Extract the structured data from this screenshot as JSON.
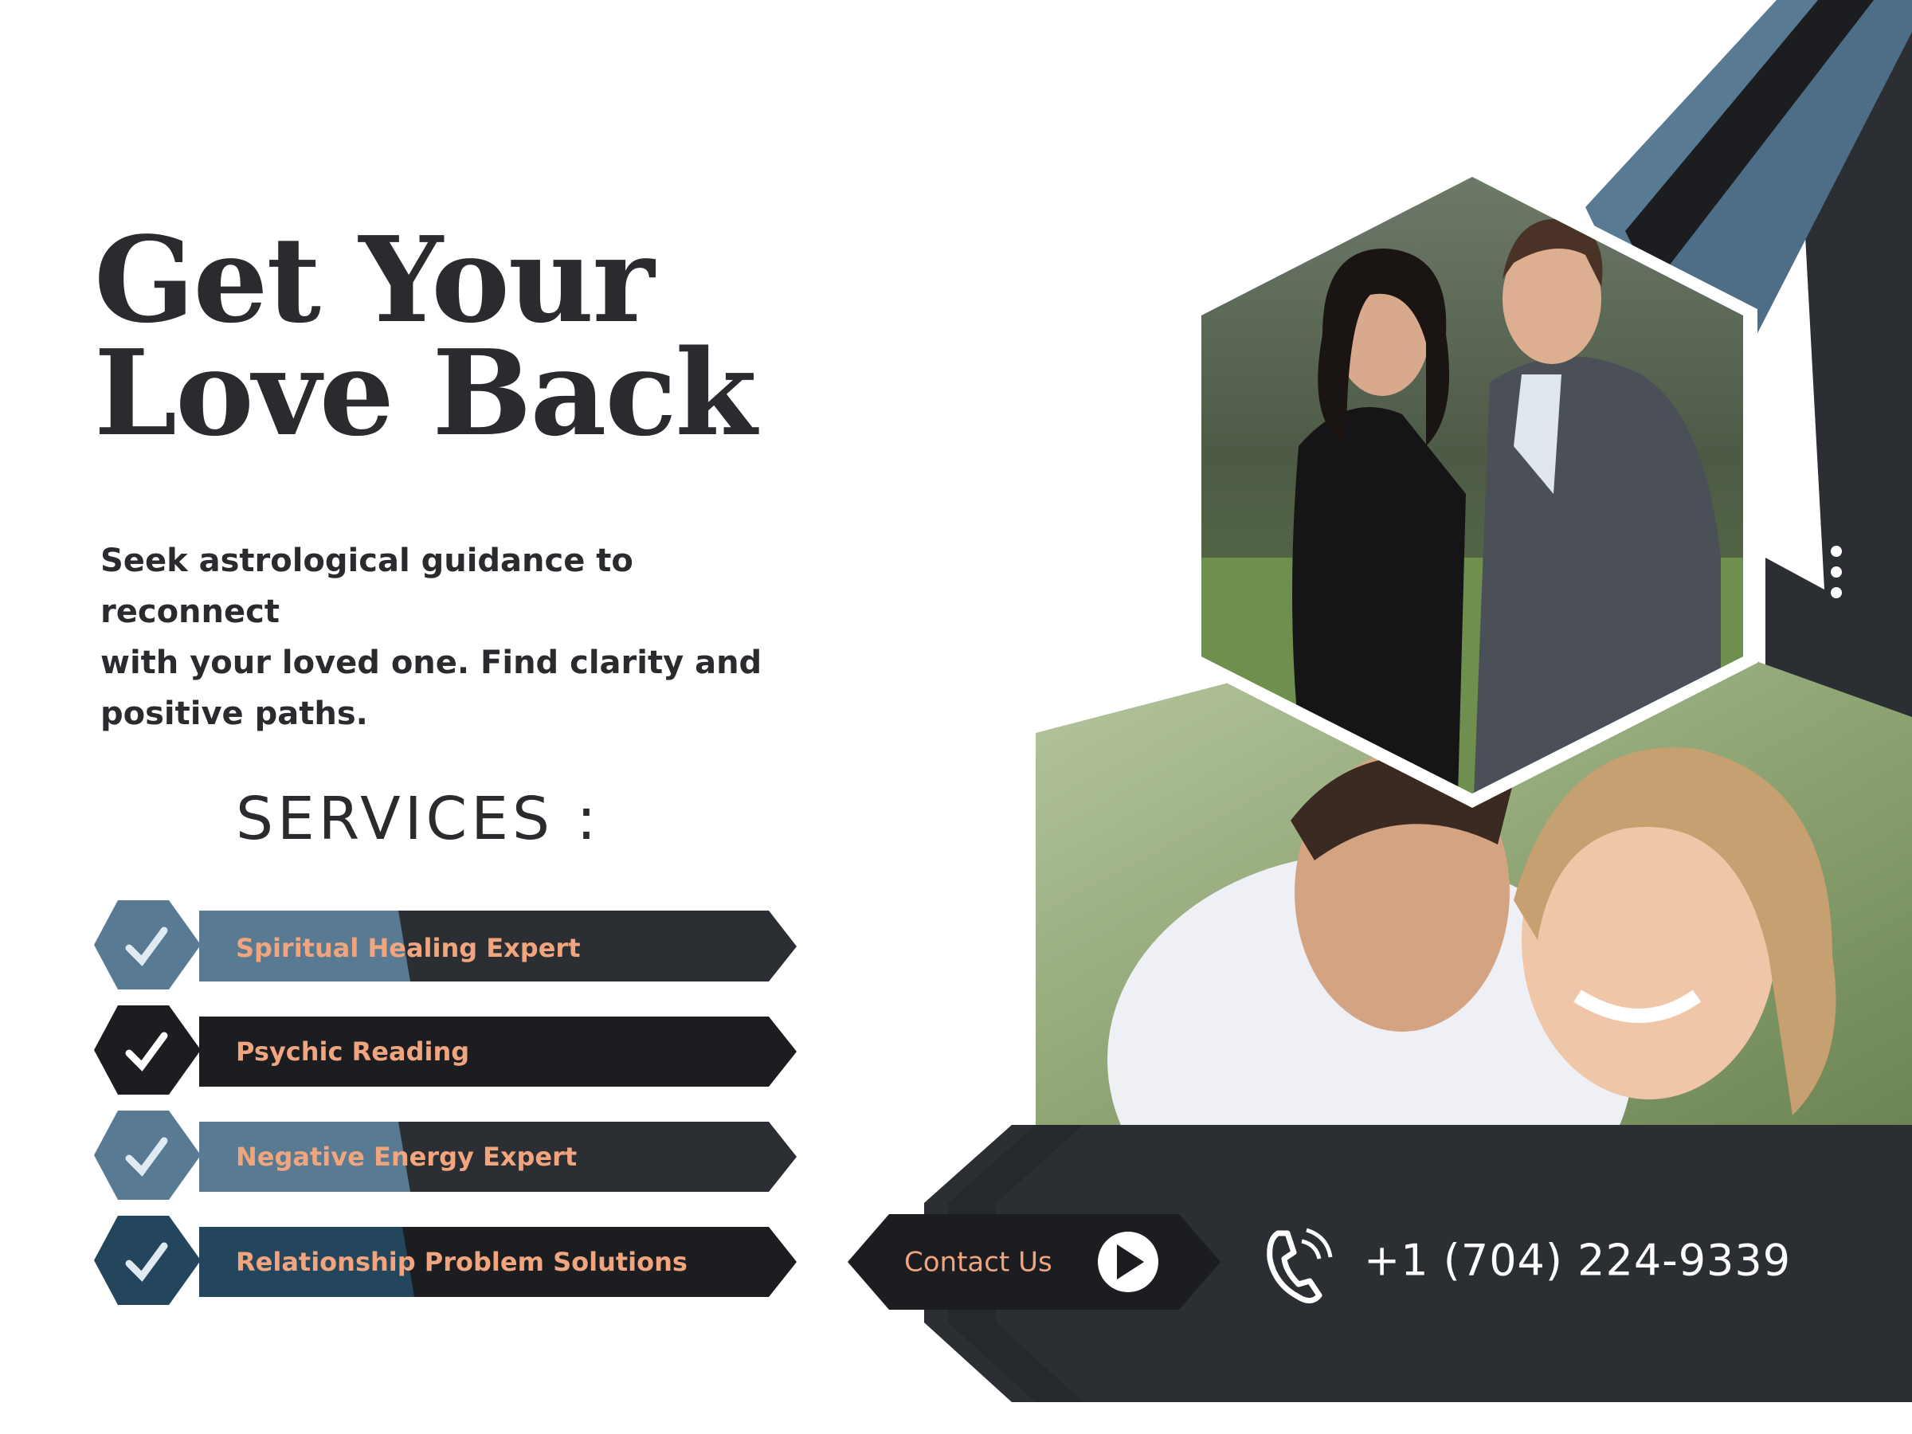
{
  "hero": {
    "title_line1": "Get Your",
    "title_line2": "Love Back",
    "subtitle_line1": "Seek astrological guidance to reconnect",
    "subtitle_line2": "with your loved one. Find clarity and",
    "subtitle_line3": "positive paths."
  },
  "services": {
    "heading": "SERVICES :",
    "items": [
      {
        "label": "Spiritual Healing Expert",
        "icon": "check-icon"
      },
      {
        "label": "Psychic Reading",
        "icon": "check-icon"
      },
      {
        "label": "Negative Energy Expert",
        "icon": "check-icon"
      },
      {
        "label": "Relationship Problem Solutions",
        "icon": "check-icon"
      }
    ]
  },
  "contact": {
    "button_label": "Contact Us",
    "button_icon": "play-arrow-icon",
    "phone_icon": "phone-icon",
    "phone": "+1 (704) 224-9339"
  },
  "menu": {
    "icon": "vertical-dots-icon"
  },
  "photos": {
    "top": "couple-portrait-photo",
    "bottom": "couple-smiling-photo"
  },
  "colors": {
    "dark": "#2b2e33",
    "darker": "#1b1d21",
    "slate_blue": "#597a93",
    "navy": "#24465c",
    "accent_orange": "#f0a57e",
    "text": "#2a2b2e"
  }
}
